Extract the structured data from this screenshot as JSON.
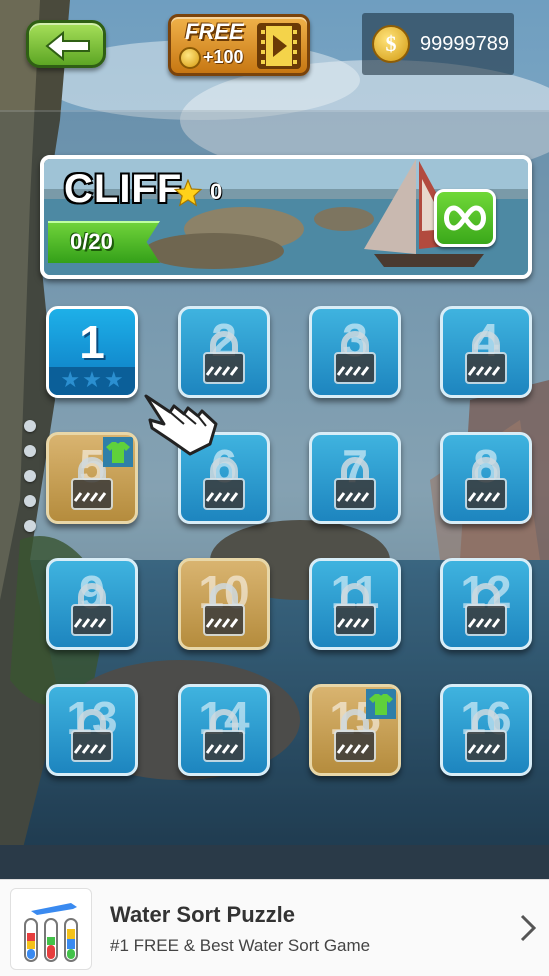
{
  "topbar": {
    "free_label": "FREE",
    "free_reward": "+100",
    "coins": "99999789"
  },
  "level_card": {
    "name": "CLIFF",
    "stars": "0",
    "progress": "0/20"
  },
  "levels": [
    {
      "number": "1",
      "state": "unlocked",
      "stars_earned": 0
    },
    {
      "number": "2",
      "state": "locked"
    },
    {
      "number": "3",
      "state": "locked"
    },
    {
      "number": "4",
      "state": "locked"
    },
    {
      "number": "5",
      "state": "locked-special",
      "reward": "shirt"
    },
    {
      "number": "6",
      "state": "locked"
    },
    {
      "number": "7",
      "state": "locked"
    },
    {
      "number": "8",
      "state": "locked"
    },
    {
      "number": "9",
      "state": "locked"
    },
    {
      "number": "10",
      "state": "locked-special"
    },
    {
      "number": "11",
      "state": "locked"
    },
    {
      "number": "12",
      "state": "locked"
    },
    {
      "number": "13",
      "state": "locked"
    },
    {
      "number": "14",
      "state": "locked"
    },
    {
      "number": "15",
      "state": "locked-special",
      "reward": "shirt"
    },
    {
      "number": "16",
      "state": "locked"
    }
  ],
  "page_indicator": {
    "count": 5,
    "current": 0
  },
  "ad": {
    "title": "Water Sort Puzzle",
    "subtitle": "#1 FREE & Best Water Sort Game"
  },
  "colors": {
    "tile_blue": "#1d85bf",
    "tile_special": "#b58c3d",
    "accent_green": "#3aa81a",
    "free_orange": "#c77713"
  }
}
